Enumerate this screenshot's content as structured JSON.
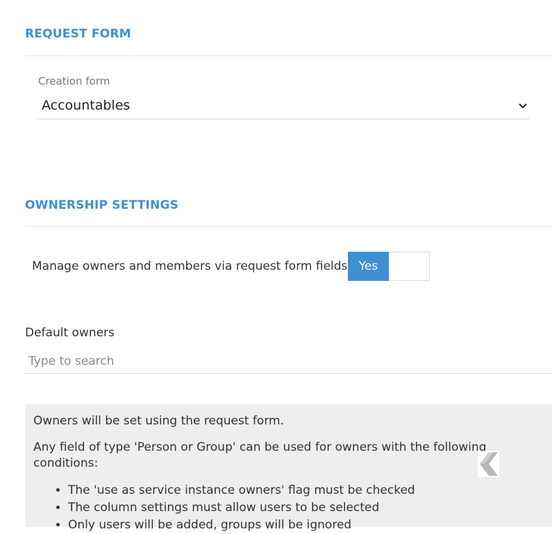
{
  "request_form": {
    "title": "REQUEST FORM",
    "creation_form_label": "Creation form",
    "creation_form_value": "Accountables"
  },
  "ownership": {
    "title": "OWNERSHIP SETTINGS",
    "manage_label": "Manage owners and members via request form fields",
    "toggle_value": "Yes",
    "default_owners_label": "Default owners",
    "search_placeholder": "Type to search"
  },
  "info": {
    "line1": "Owners will be set using the request form.",
    "line2": "Any field of type 'Person or Group' can be used for owners with the following conditions:",
    "conditions": [
      "The 'use as service instance owners' flag must be checked",
      "The column settings must allow users to be selected",
      "Only users will be added, groups will be ignored"
    ]
  },
  "colors": {
    "accent": "#3f8fd2",
    "info_background": "#eeeeee"
  }
}
